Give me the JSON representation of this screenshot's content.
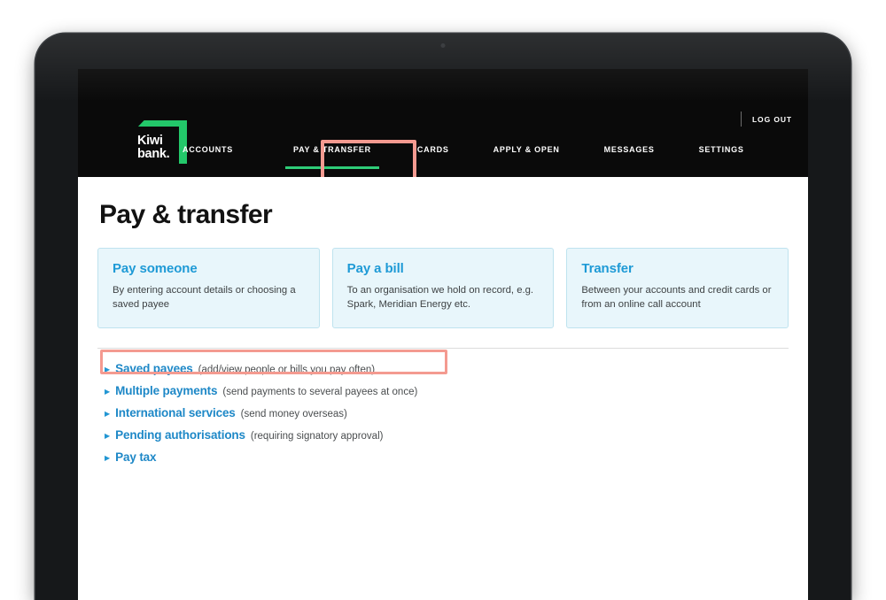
{
  "device": {
    "type": "tablet"
  },
  "header": {
    "logo": {
      "line1": "Kiwi",
      "line2": "bank.",
      "accent_color": "#23c86a"
    },
    "logout_label": "LOG OUT",
    "nav": [
      {
        "label": "ACCOUNTS",
        "active": false
      },
      {
        "label": "PAY & TRANSFER",
        "active": true
      },
      {
        "label": "CARDS",
        "active": false
      },
      {
        "label": "APPLY & OPEN",
        "active": false
      },
      {
        "label": "MESSAGES",
        "active": false
      },
      {
        "label": "SETTINGS",
        "active": false
      }
    ]
  },
  "main": {
    "page_title": "Pay & transfer",
    "cards": [
      {
        "title": "Pay someone",
        "desc": "By entering account details or choosing a saved payee"
      },
      {
        "title": "Pay a bill",
        "desc": "To an organisation we hold on record, e.g. Spark, Meridian Energy etc."
      },
      {
        "title": "Transfer",
        "desc": "Between your accounts and credit cards or from an online call account"
      }
    ],
    "links": [
      {
        "label": "Saved payees",
        "note": "(add/view people or bills you pay often)",
        "highlighted": true
      },
      {
        "label": "Multiple payments",
        "note": "(send payments to several payees at once)",
        "highlighted": false
      },
      {
        "label": "International services",
        "note": "(send money overseas)",
        "highlighted": false
      },
      {
        "label": "Pending authorisations",
        "note": "(requiring signatory approval)",
        "highlighted": false
      },
      {
        "label": "Pay tax",
        "note": "",
        "highlighted": false
      }
    ]
  },
  "annotations": {
    "color": "#f49a90",
    "targets": [
      "PAY & TRANSFER",
      "Saved payees"
    ]
  },
  "colors": {
    "brand_green": "#23c86a",
    "link_blue": "#1e88c7",
    "card_bg": "#e8f6fb",
    "card_border": "#bfe3ef",
    "topbar_bg": "#0a0a0a",
    "highlight": "#f49a90"
  }
}
